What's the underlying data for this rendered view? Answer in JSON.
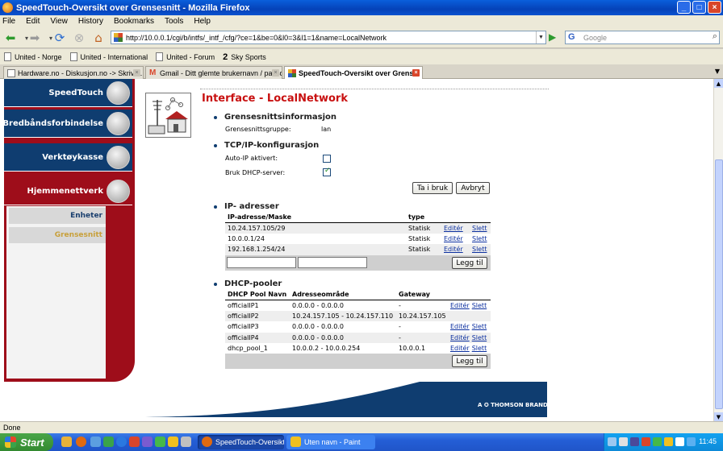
{
  "window": {
    "title": "SpeedTouch-Oversikt over Grensesnitt - Mozilla Firefox",
    "min": "_",
    "max": "□",
    "close": "×"
  },
  "menu": [
    "File",
    "Edit",
    "View",
    "History",
    "Bookmarks",
    "Tools",
    "Help"
  ],
  "nav": {
    "url": "http://10.0.0.1/cgi/b/intfs/_intf_/cfg/?ce=1&be=0&l0=3&l1=1&name=LocalNetwork",
    "search_placeholder": "Google",
    "search_engine_glyph": "G"
  },
  "bookmarks": [
    {
      "label": "United - Norge",
      "icon": "page-icon"
    },
    {
      "label": "United - International",
      "icon": "page-icon"
    },
    {
      "label": "United - Forum",
      "icon": "page-icon"
    },
    {
      "label": "Sky Sports",
      "icon": "sky-icon",
      "glyph": "2"
    }
  ],
  "tabs": [
    {
      "label": "Hardware.no - Diskusjon.no -> Skriv n...",
      "active": false
    },
    {
      "label": "Gmail - Ditt glemte brukernavn / passord",
      "active": false
    },
    {
      "label": "SpeedTouch-Oversikt over Grens...",
      "active": true
    }
  ],
  "sidebar": {
    "items": [
      {
        "label": "SpeedTouch"
      },
      {
        "label": "Bredbåndsforbindelse"
      },
      {
        "label": "Verktøykasse"
      },
      {
        "label": "Hjemmenettverk"
      }
    ],
    "sub_items": [
      {
        "label": "Enheter",
        "active": false
      },
      {
        "label": "Grensesnitt",
        "active": true
      }
    ]
  },
  "page": {
    "title": "Interface - LocalNetwork",
    "interface_info": {
      "heading": "Grensesnittsinformasjon",
      "group_label": "Grensesnittsgruppe:",
      "group_value": "lan"
    },
    "tcpip": {
      "heading": "TCP/IP-konfigurasjon",
      "auto_ip_label": "Auto-IP aktivert:",
      "auto_ip_checked": false,
      "dhcp_label": "Bruk DHCP-server:",
      "dhcp_checked": true,
      "apply_label": "Ta i bruk",
      "cancel_label": "Avbryt"
    },
    "ip_addresses": {
      "heading": "IP- adresser",
      "columns": [
        "IP-adresse/Maske",
        "type"
      ],
      "rows": [
        {
          "address": "10.24.157.105/29",
          "type": "Statisk",
          "edit": "Editér",
          "delete": "Slett"
        },
        {
          "address": "10.0.0.1/24",
          "type": "Statisk",
          "edit": "Editér",
          "delete": "Slett"
        },
        {
          "address": "192.168.1.254/24",
          "type": "Statisk",
          "edit": "Editér",
          "delete": "Slett"
        }
      ],
      "add_label": "Legg til"
    },
    "dhcp_pools": {
      "heading": "DHCP-pooler",
      "columns": [
        "DHCP Pool Navn",
        "Adresseområde",
        "Gateway"
      ],
      "rows": [
        {
          "name": "officialIP1",
          "range": "0.0.0.0 - 0.0.0.0",
          "gateway": "-",
          "edit": "Editér",
          "delete": "Slett"
        },
        {
          "name": "officialIP2",
          "range": "10.24.157.105 - 10.24.157.110",
          "gateway": "10.24.157.105",
          "edit": "",
          "delete": ""
        },
        {
          "name": "officialIP3",
          "range": "0.0.0.0 - 0.0.0.0",
          "gateway": "-",
          "edit": "Editér",
          "delete": "Slett"
        },
        {
          "name": "officialIP4",
          "range": "0.0.0.0 - 0.0.0.0",
          "gateway": "-",
          "edit": "Editér",
          "delete": "Slett"
        },
        {
          "name": "dhcp_pool_1",
          "range": "10.0.0.2 - 10.0.0.254",
          "gateway": "10.0.0.1",
          "edit": "Editér",
          "delete": "Slett"
        }
      ],
      "add_label": "Legg til"
    },
    "brand": "A ✪ THOMSON BRAND"
  },
  "status": "Done",
  "taskbar": {
    "start": "Start",
    "buttons": [
      {
        "label": "SpeedTouch-Oversikt...",
        "active": true
      },
      {
        "label": "Uten navn - Paint",
        "active": false
      }
    ],
    "clock": "11:45"
  },
  "colors": {
    "nav_blue": "#0f3d70",
    "brand_red": "#9e0d1a",
    "title_red": "#c81010",
    "link_blue": "#0b2f9f",
    "active_sub": "#c8a03a"
  }
}
